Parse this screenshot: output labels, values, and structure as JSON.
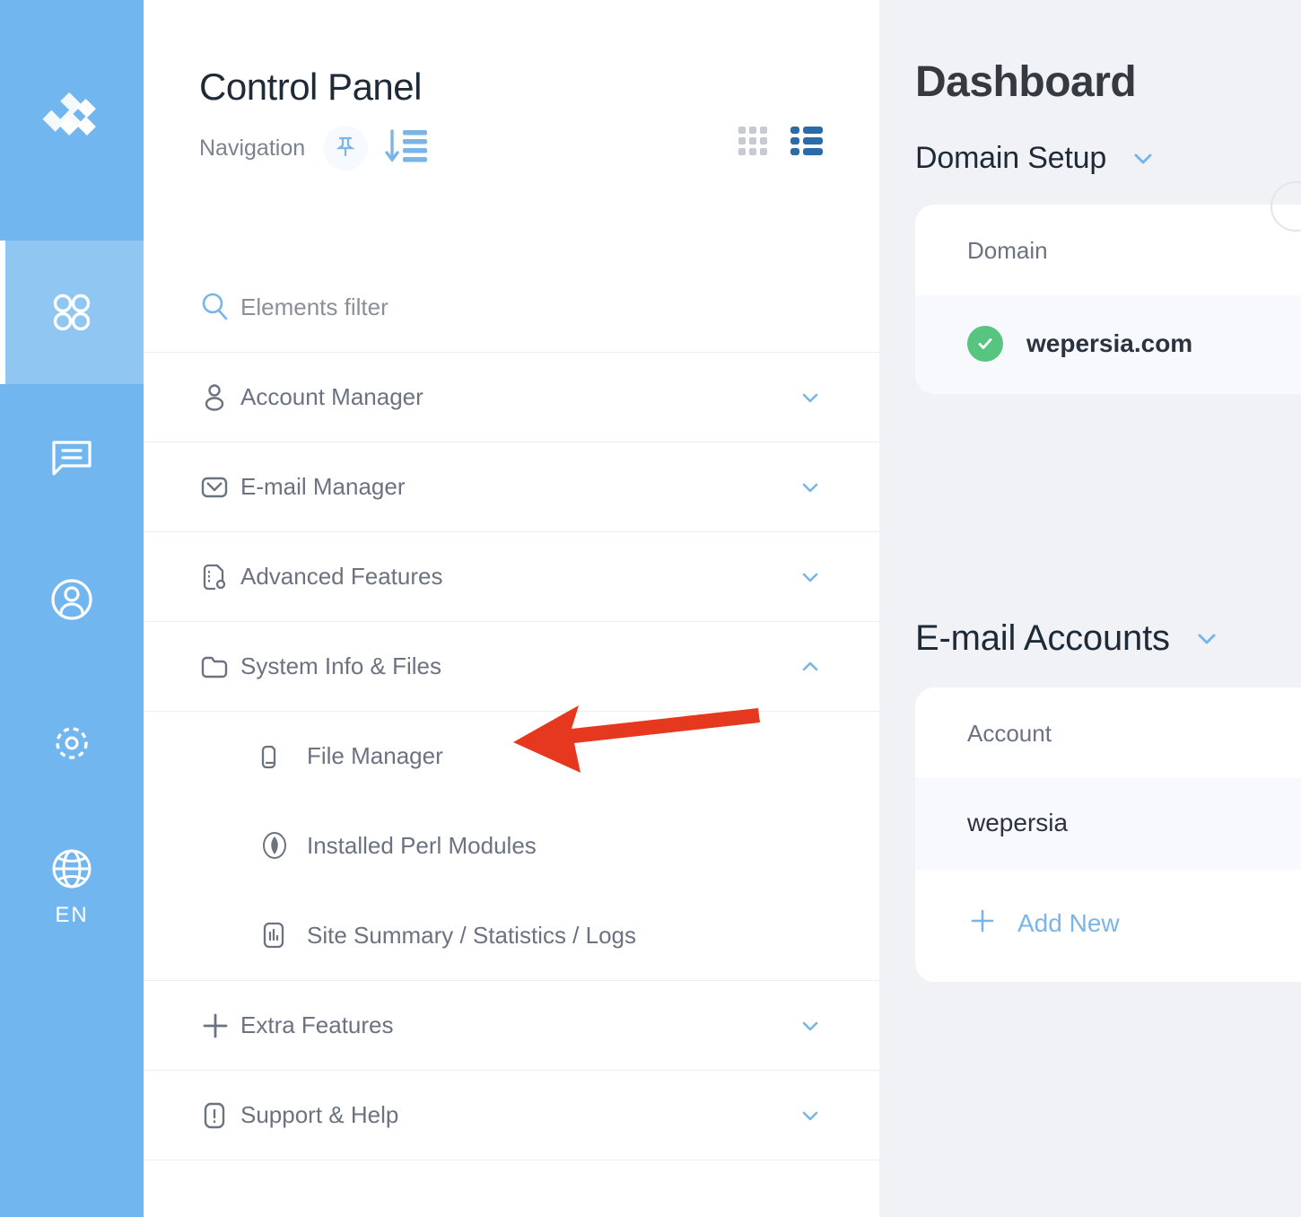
{
  "colors": {
    "rail_bg": "#72b6f0",
    "rail_active_bg": "#90c6f2",
    "accent_blue": "#7ab5e8",
    "toggle_active": "#2c6aa8",
    "status_green": "#57c47f",
    "arrow_red": "#e5381f",
    "panel_bg": "#f1f2f6"
  },
  "rail": {
    "logo_name": "chevrons-logo",
    "items": [
      {
        "name": "apps-grid-icon",
        "label": "",
        "active": true
      },
      {
        "name": "chat-bubble-icon",
        "label": "",
        "active": false
      },
      {
        "name": "user-circle-icon",
        "label": "",
        "active": false
      },
      {
        "name": "settings-gear-icon",
        "label": "",
        "active": false
      },
      {
        "name": "globe-icon",
        "label": "EN",
        "active": false
      }
    ],
    "language": "EN"
  },
  "nav": {
    "title": "Control Panel",
    "subtitle": "Navigation",
    "pin_icon": "pin-icon",
    "sort_icon": "sort-descending-icon",
    "grid_view_icon": "grid-view-icon",
    "list_view_icon": "list-view-icon",
    "search": {
      "label": "Elements filter",
      "icon": "search-icon"
    },
    "items": [
      {
        "label": "Account Manager",
        "icon": "user-icon",
        "chevron": "chevron-down",
        "level": "top"
      },
      {
        "label": "E-mail Manager",
        "icon": "envelope-icon",
        "chevron": "chevron-down",
        "level": "top"
      },
      {
        "label": "Advanced Features",
        "icon": "document-gear-icon",
        "chevron": "chevron-down",
        "level": "top"
      },
      {
        "label": "System Info & Files",
        "icon": "folder-icon",
        "chevron": "chevron-up",
        "level": "top"
      },
      {
        "label": "File Manager",
        "icon": "folder-file-icon",
        "chevron": "",
        "level": "sub"
      },
      {
        "label": "Installed Perl Modules",
        "icon": "perl-onion-icon",
        "chevron": "",
        "level": "sub"
      },
      {
        "label": "Site Summary / Statistics / Logs",
        "icon": "bar-chart-icon",
        "chevron": "",
        "level": "sub"
      },
      {
        "label": "Extra Features",
        "icon": "plus-icon",
        "chevron": "chevron-down",
        "level": "top"
      },
      {
        "label": "Support & Help",
        "icon": "exclamation-box-icon",
        "chevron": "chevron-down",
        "level": "top"
      }
    ]
  },
  "dashboard": {
    "title": "Dashboard",
    "sections": [
      {
        "title": "Domain Setup",
        "chevron": "chevron-down",
        "card": {
          "header": "Domain",
          "rows": [
            {
              "text": "wepersia.com",
              "status": "ok",
              "status_icon": "check-circle-icon"
            }
          ]
        }
      },
      {
        "title": "E-mail Accounts",
        "chevron": "chevron-down",
        "card": {
          "header": "Account",
          "rows": [
            {
              "text": "wepersia",
              "status": "",
              "status_icon": ""
            }
          ],
          "add_new_label": "Add New",
          "add_new_icon": "plus-icon"
        }
      }
    ]
  },
  "annotation": {
    "arrow_name": "red-pointer-arrow",
    "points_to": "File Manager"
  }
}
